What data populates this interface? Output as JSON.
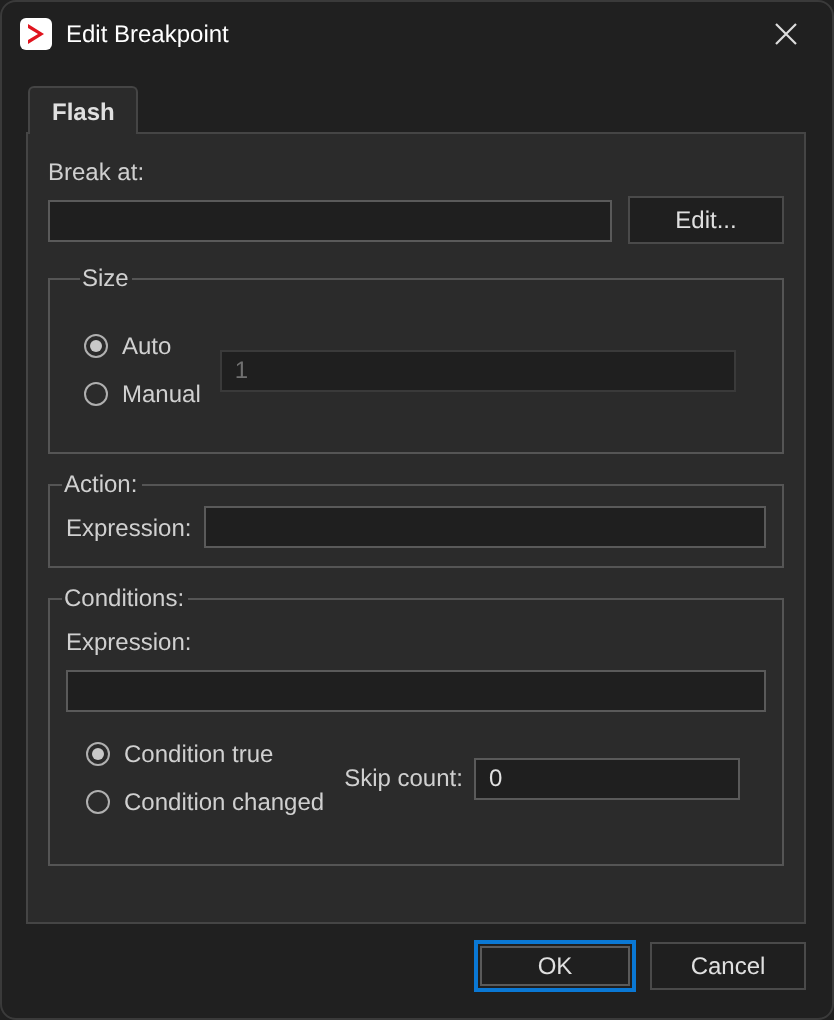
{
  "window": {
    "title": "Edit Breakpoint"
  },
  "tabs": [
    {
      "label": "Flash",
      "selected": true
    }
  ],
  "break_at": {
    "label": "Break at:",
    "button": "Edit..."
  },
  "size": {
    "title": "Size",
    "disabled": true,
    "value": "1",
    "options": [
      {
        "label": "Auto",
        "selected": true
      },
      {
        "label": "Manual",
        "selected": false
      }
    ]
  },
  "action": {
    "title": "Action:",
    "expression_label": "Expression:"
  },
  "conditions": {
    "title": "Conditions:",
    "expression_label": "Expression:",
    "skip_count_label": "Skip count:",
    "skip_count": "0",
    "options": [
      {
        "label": "Condition true",
        "selected": true
      },
      {
        "label": "Condition changed",
        "selected": false
      }
    ]
  },
  "buttons": [
    {
      "label": "OK",
      "focused": true
    },
    {
      "label": "Cancel",
      "focused": false
    }
  ]
}
